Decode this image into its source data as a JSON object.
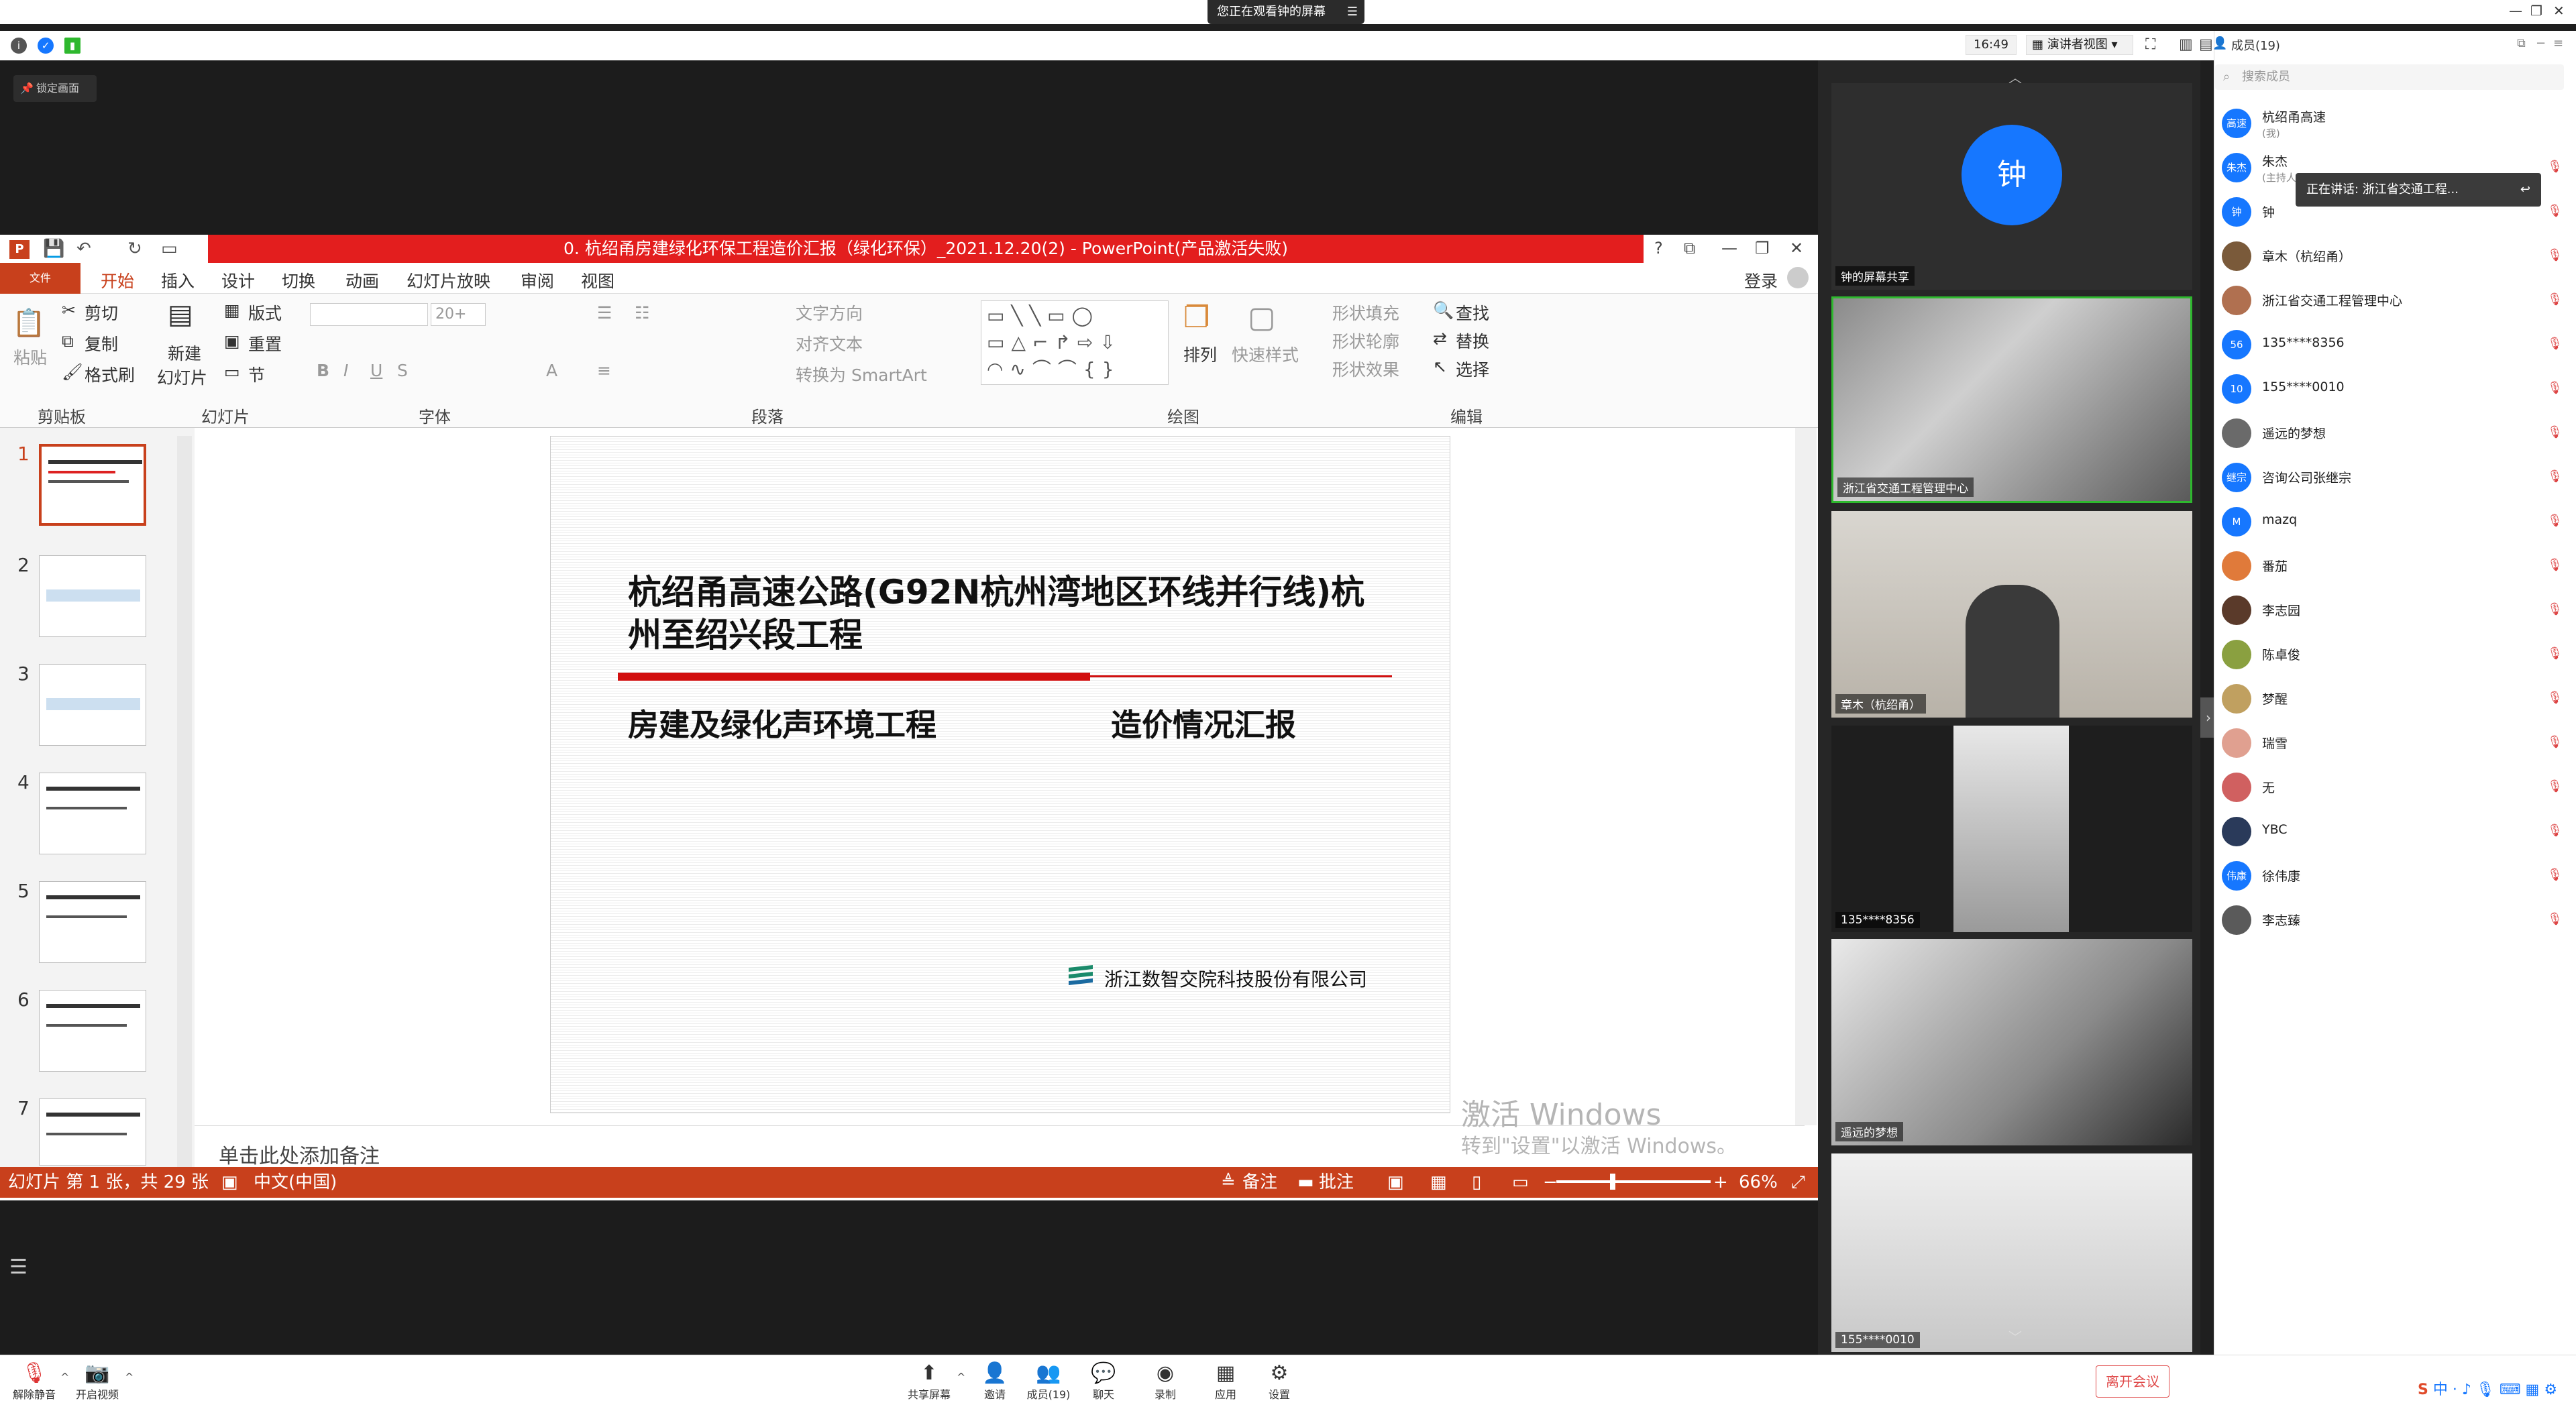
{
  "banner": {
    "text": "您正在观看钟的屏幕",
    "menu": "☰"
  },
  "window_controls": [
    "—",
    "❐",
    "✕"
  ],
  "meeting_bar": {
    "time": "16:49",
    "view": "演讲者视图",
    "lock": "锁定画面"
  },
  "ppt": {
    "title": "0. 杭绍甬房建绿化环保工程造价汇报（绿化环保）_2021.12.20(2) -  PowerPoint(产品激活失败)",
    "title_right": [
      "?",
      "⧉",
      "—",
      "❐",
      "✕"
    ],
    "login": "登录",
    "tabs": [
      "文件",
      "开始",
      "插入",
      "设计",
      "切换",
      "动画",
      "幻灯片放映",
      "审阅",
      "视图"
    ],
    "clipboard": {
      "paste": "粘贴",
      "cut": "剪切",
      "copy": "复制",
      "format": "格式刷",
      "label": "剪贴板"
    },
    "slides_grp": {
      "new": "新建",
      "new2": "幻灯片",
      "layout": "版式",
      "reset": "重置",
      "section": "节",
      "label": "幻灯片"
    },
    "font_grp": {
      "size": "20+",
      "label": "字体"
    },
    "para_grp": {
      "textdir": "文字方向",
      "align": "对齐文本",
      "smartart": "转换为 SmartArt",
      "label": "段落"
    },
    "draw_grp": {
      "arrange": "排列",
      "quick": "快速样式",
      "fill": "形状填充",
      "outline": "形状轮廓",
      "effect": "形状效果",
      "label": "绘图"
    },
    "edit_grp": {
      "find": "查找",
      "replace": "替换",
      "select": "选择",
      "label": "编辑"
    },
    "thumb_numbers": [
      "1",
      "2",
      "3",
      "4",
      "5",
      "6",
      "7"
    ],
    "slide": {
      "title": "杭绍甬高速公路(G92N杭州湾地区环线并行线)杭州至绍兴段工程",
      "subtitle_left": "房建及绿化声环境工程",
      "subtitle_right": "造价情况汇报",
      "company": "浙江数智交院科技股份有限公司"
    },
    "notes_placeholder": "单击此处添加备注",
    "status": {
      "slide_info": "幻灯片 第 1 张，共 29 张",
      "lang": "中文(中国)",
      "notes": "备注",
      "comments": "批注",
      "zoom": "66%"
    },
    "watermark": {
      "line1": "激活 Windows",
      "line2": "转到\"设置\"以激活 Windows。"
    }
  },
  "videos": [
    {
      "label": "钟的屏幕共享",
      "avatar": "钟"
    },
    {
      "label": "浙江省交通工程管理中心"
    },
    {
      "label": "章木（杭绍甬）"
    },
    {
      "label": "135****8356"
    },
    {
      "label": "遥远的梦想"
    },
    {
      "label": "155****0010"
    }
  ],
  "members": {
    "title": "成员(19)",
    "search_placeholder": "搜索成员",
    "tooltip": "正在讲话: 浙江省交通工程...",
    "list": [
      {
        "name": "杭绍甬高速",
        "sub": "(我)",
        "av": "高速",
        "color": "#1677ff"
      },
      {
        "name": "朱杰",
        "sub": "(主持人)",
        "av": "朱杰",
        "color": "#1677ff"
      },
      {
        "name": "钟",
        "sub": "",
        "av": "钟",
        "color": "#1677ff"
      },
      {
        "name": "章木（杭绍甬）",
        "sub": "",
        "av": "",
        "color": "#7a5a3a"
      },
      {
        "name": "浙江省交通工程管理中心",
        "sub": "",
        "av": "",
        "color": "#b07050"
      },
      {
        "name": "135****8356",
        "sub": "",
        "av": "56",
        "color": "#1677ff"
      },
      {
        "name": "155****0010",
        "sub": "",
        "av": "10",
        "color": "#1677ff"
      },
      {
        "name": "遥远的梦想",
        "sub": "",
        "av": "",
        "color": "#6a6a6a"
      },
      {
        "name": "咨询公司张继宗",
        "sub": "",
        "av": "继宗",
        "color": "#1677ff"
      },
      {
        "name": "mazq",
        "sub": "",
        "av": "M",
        "color": "#1677ff"
      },
      {
        "name": "番茄",
        "sub": "",
        "av": "",
        "color": "#e07a3a"
      },
      {
        "name": "李志园",
        "sub": "",
        "av": "",
        "color": "#5a3a2a"
      },
      {
        "name": "陈卓俊",
        "sub": "",
        "av": "",
        "color": "#8aa040"
      },
      {
        "name": "梦醒",
        "sub": "",
        "av": "",
        "color": "#c0a060"
      },
      {
        "name": "瑞雪",
        "sub": "",
        "av": "",
        "color": "#e0a090"
      },
      {
        "name": "无",
        "sub": "",
        "av": "",
        "color": "#d06060"
      },
      {
        "name": "YBC",
        "sub": "",
        "av": "",
        "color": "#2a3a5a"
      },
      {
        "name": "徐伟康",
        "sub": "",
        "av": "伟康",
        "color": "#1677ff"
      },
      {
        "name": "李志臻",
        "sub": "",
        "av": "",
        "color": "#5a5a5a"
      }
    ]
  },
  "bottom": {
    "mute": "解除静音",
    "video": "开启视频",
    "share": "共享屏幕",
    "invite": "邀请",
    "members": "成员(19)",
    "chat": "聊天",
    "record": "录制",
    "apps": "应用",
    "settings": "设置",
    "leave": "离开会议"
  },
  "colors": {
    "ppt_accent": "#c8401c",
    "zoom_blue": "#1677ff",
    "title_red": "#e31e1e"
  }
}
